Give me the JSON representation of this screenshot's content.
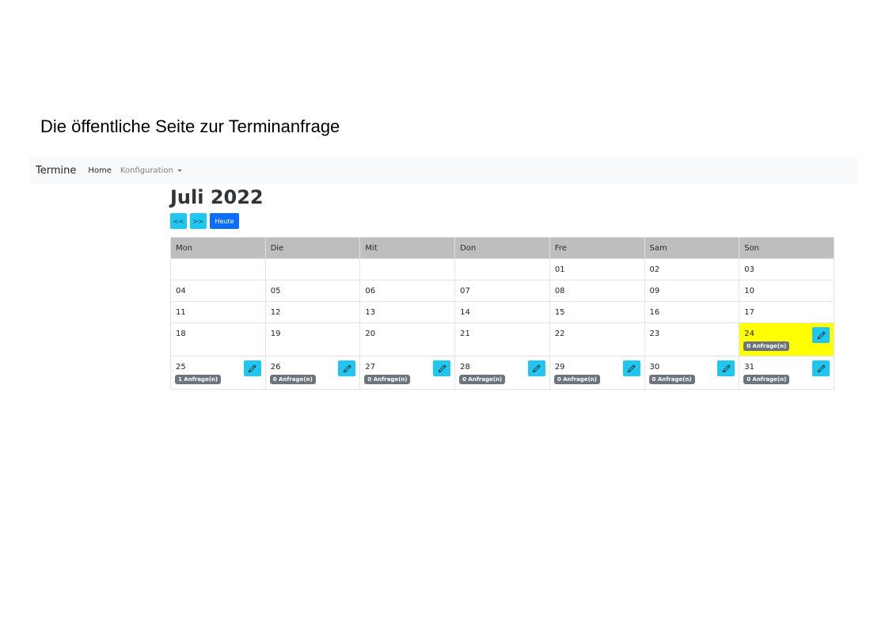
{
  "caption": "Die öffentliche Seite zur Terminanfrage",
  "navbar": {
    "brand": "Termine",
    "home": "Home",
    "config": "Konfiguration"
  },
  "calendar": {
    "title": "Juli 2022",
    "buttons": {
      "prev": "<<",
      "next": ">>",
      "today": "Heute"
    },
    "weekdays": [
      "Mon",
      "Die",
      "Mit",
      "Don",
      "Fre",
      "Sam",
      "Son"
    ],
    "weeks": [
      [
        null,
        null,
        null,
        null,
        {
          "day": "01"
        },
        {
          "day": "02"
        },
        {
          "day": "03"
        }
      ],
      [
        {
          "day": "04"
        },
        {
          "day": "05"
        },
        {
          "day": "06"
        },
        {
          "day": "07"
        },
        {
          "day": "08"
        },
        {
          "day": "09"
        },
        {
          "day": "10"
        }
      ],
      [
        {
          "day": "11"
        },
        {
          "day": "12"
        },
        {
          "day": "13"
        },
        {
          "day": "14"
        },
        {
          "day": "15"
        },
        {
          "day": "16"
        },
        {
          "day": "17"
        }
      ],
      [
        {
          "day": "18"
        },
        {
          "day": "19"
        },
        {
          "day": "20"
        },
        {
          "day": "21"
        },
        {
          "day": "22"
        },
        {
          "day": "23"
        },
        {
          "day": "24",
          "today": true,
          "badge": "0 Anfrage(n)"
        }
      ],
      [
        {
          "day": "25",
          "badge": "1 Anfrage(n)"
        },
        {
          "day": "26",
          "badge": "0 Anfrage(n)"
        },
        {
          "day": "27",
          "badge": "0 Anfrage(n)"
        },
        {
          "day": "28",
          "badge": "0 Anfrage(n)"
        },
        {
          "day": "29",
          "badge": "0 Anfrage(n)"
        },
        {
          "day": "30",
          "badge": "0 Anfrage(n)"
        },
        {
          "day": "31",
          "badge": "0 Anfrage(n)"
        }
      ]
    ],
    "edit_icon": "pencil-icon"
  },
  "colors": {
    "today_highlight": "#ffff00",
    "header_bg": "#bebebe",
    "info_button": "#1fc6ef",
    "primary_button": "#0d6efd",
    "badge": "#6c757d"
  }
}
